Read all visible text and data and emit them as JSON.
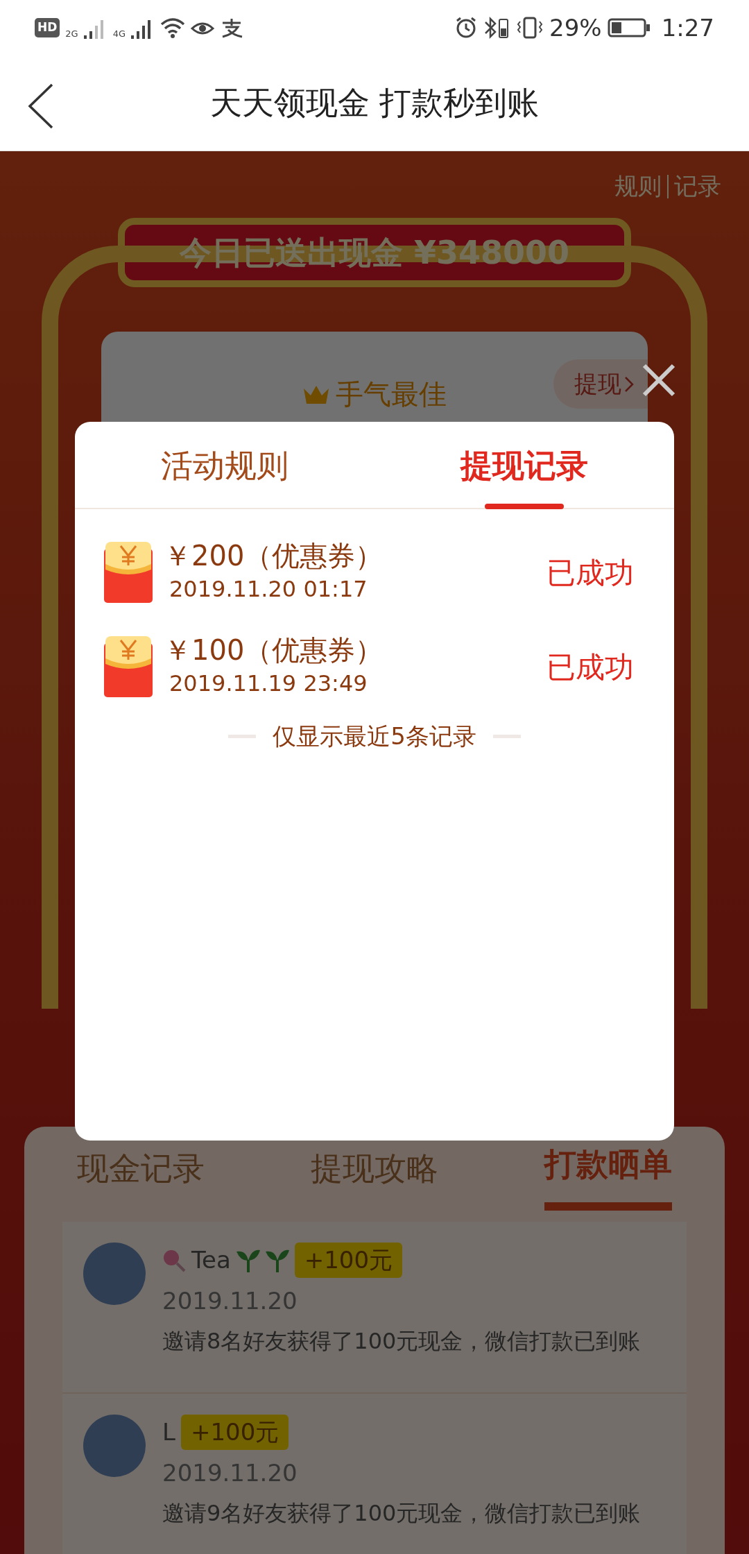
{
  "status_bar": {
    "hd_label": "HD",
    "sim1_network": "2G",
    "sim2_network": "4G",
    "battery_percent": "29%",
    "time": "1:27"
  },
  "header": {
    "title": "天天领现金 打款秒到账"
  },
  "background_page": {
    "top_links": [
      "规则",
      "记录"
    ],
    "banner": "今日已送出现金 ¥348000",
    "card": {
      "title": "手气最佳",
      "button": "提现"
    },
    "tabs": [
      {
        "label": "现金记录",
        "selected": false
      },
      {
        "label": "提现攻略",
        "selected": false
      },
      {
        "label": "打款晒单",
        "selected": true
      }
    ],
    "posts": [
      {
        "kind": "decorated",
        "name": "Tea",
        "badge": "+100元",
        "date": "2019.11.20",
        "message": "邀请8名好友获得了100元现金，微信打款已到账"
      },
      {
        "kind": "plain",
        "name": "L",
        "badge": "+100元",
        "date": "2019.11.20",
        "message": "邀请9名好友获得了100元现金，微信打款已到账"
      }
    ]
  },
  "dialog": {
    "tabs": [
      {
        "label": "活动规则",
        "selected": false
      },
      {
        "label": "提现记录",
        "selected": true
      }
    ],
    "records": [
      {
        "amount": "￥200（优惠券）",
        "time": "2019.11.20 01:17",
        "status": "已成功"
      },
      {
        "amount": "￥100（优惠券）",
        "time": "2019.11.19 23:49",
        "status": "已成功"
      }
    ],
    "footer_note": "仅显示最近5条记录"
  }
}
